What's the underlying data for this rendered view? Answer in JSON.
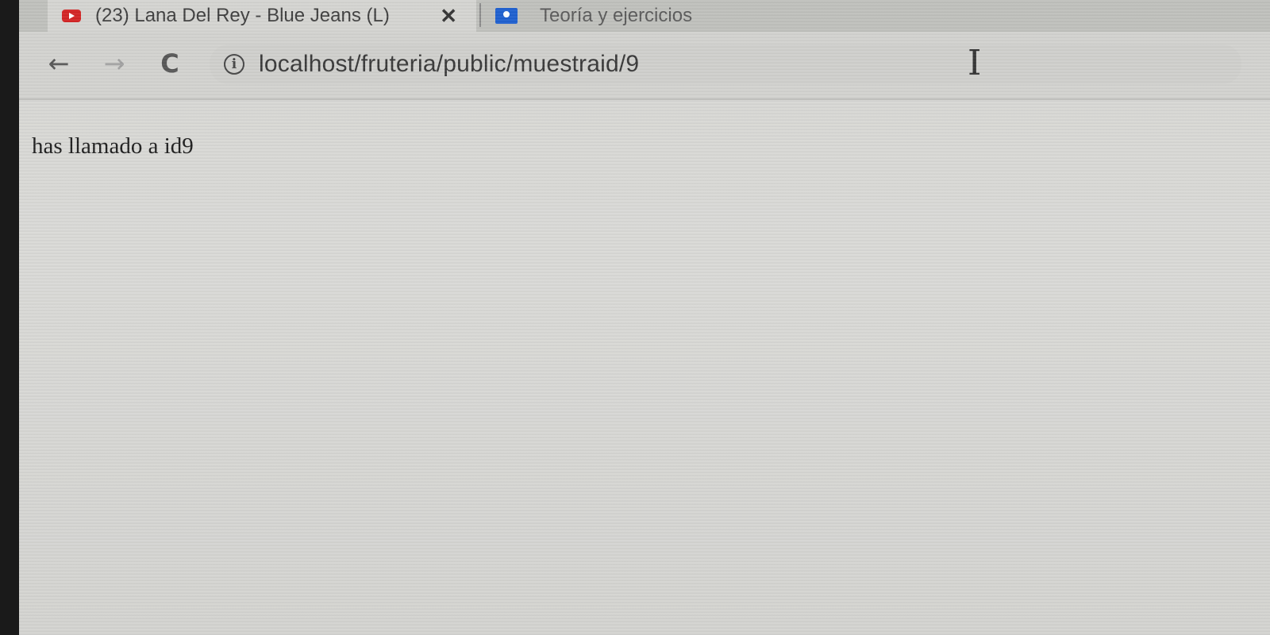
{
  "browser": {
    "tabs": [
      {
        "title": "(23) Lana Del Rey - Blue Jeans (L)",
        "icon": "youtube-icon",
        "active": true,
        "close_glyph": "✕"
      },
      {
        "title": "Teoría y ejercicios",
        "icon": "docs-icon",
        "active": false
      }
    ],
    "toolbar": {
      "back_glyph": "←",
      "forward_glyph": "→",
      "reload_glyph": "C",
      "info_glyph": "i",
      "url": "localhost/fruteria/public/muestraid/9"
    }
  },
  "page": {
    "body_text": "has llamado a id9"
  },
  "colors": {
    "youtube_red": "#d32323",
    "docs_blue": "#1e5fcf"
  }
}
